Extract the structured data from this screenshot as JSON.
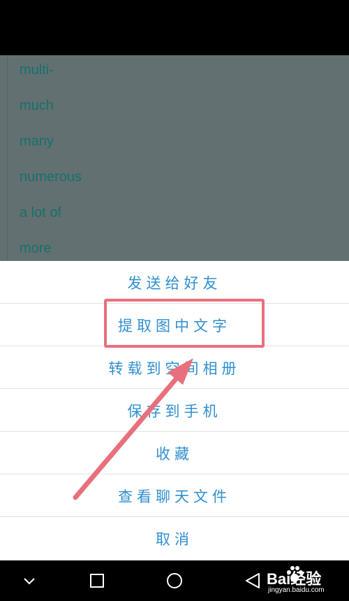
{
  "background_words": [
    "multi-",
    "much",
    "many",
    "numerous",
    "a lot of",
    "more"
  ],
  "action_sheet": {
    "items": [
      {
        "label": "发送给好友"
      },
      {
        "label": "提取图中文字"
      },
      {
        "label": "转载到空间相册"
      },
      {
        "label": "保存到手机"
      },
      {
        "label": "收藏"
      },
      {
        "label": "查看聊天文件"
      },
      {
        "label": "取消"
      }
    ],
    "highlighted_index": 1
  },
  "nav_bar": {
    "icons": [
      "chevron-down-icon",
      "recents-square-icon",
      "home-circle-icon",
      "back-triangle-icon"
    ]
  },
  "watermark": {
    "logo": "Bai经验",
    "url": "jingyan.baidu.com"
  },
  "colors": {
    "overlay": "#627072",
    "word_text": "#17706c",
    "sheet_text": "#2f8fd0",
    "highlight": "#e8707c"
  }
}
